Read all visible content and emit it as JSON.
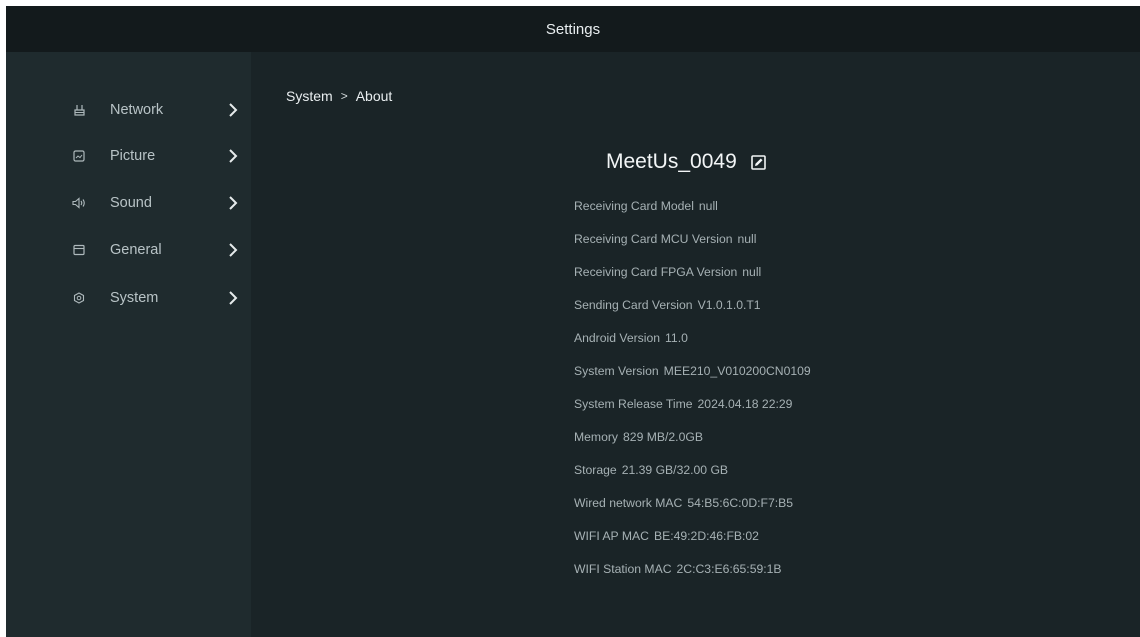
{
  "header": {
    "title": "Settings"
  },
  "sidebar": {
    "items": [
      {
        "label": "Network",
        "icon": "network-icon"
      },
      {
        "label": "Picture",
        "icon": "picture-icon"
      },
      {
        "label": "Sound",
        "icon": "sound-icon"
      },
      {
        "label": "General",
        "icon": "general-icon"
      },
      {
        "label": "System",
        "icon": "system-icon"
      }
    ]
  },
  "breadcrumb": {
    "parent": "System",
    "separator": ">",
    "current": "About"
  },
  "device": {
    "name": "MeetUs_0049",
    "edit_icon": "edit-icon"
  },
  "info": [
    {
      "label": "Receiving Card Model",
      "value": "null"
    },
    {
      "label": "Receiving Card MCU Version",
      "value": "null"
    },
    {
      "label": "Receiving Card FPGA Version",
      "value": "null"
    },
    {
      "label": "Sending Card Version",
      "value": "V1.0.1.0.T1"
    },
    {
      "label": "Android Version",
      "value": "11.0"
    },
    {
      "label": "System Version",
      "value": "MEE210_V010200CN0109"
    },
    {
      "label": "System Release Time",
      "value": "2024.04.18 22:29"
    },
    {
      "label": "Memory",
      "value": "829 MB/2.0GB"
    },
    {
      "label": "Storage",
      "value": "21.39 GB/32.00 GB"
    },
    {
      "label": "Wired network MAC",
      "value": "54:B5:6C:0D:F7:B5"
    },
    {
      "label": "WIFI AP MAC",
      "value": "BE:49:2D:46:FB:02"
    },
    {
      "label": "WIFI Station MAC",
      "value": "2C:C3:E6:65:59:1B"
    }
  ],
  "colors": {
    "background": "#1a2427",
    "sidebar": "#1f2b2e",
    "titlebar": "#131a1c",
    "text_primary": "#e9eef0",
    "text_secondary": "#a6b1b4"
  }
}
